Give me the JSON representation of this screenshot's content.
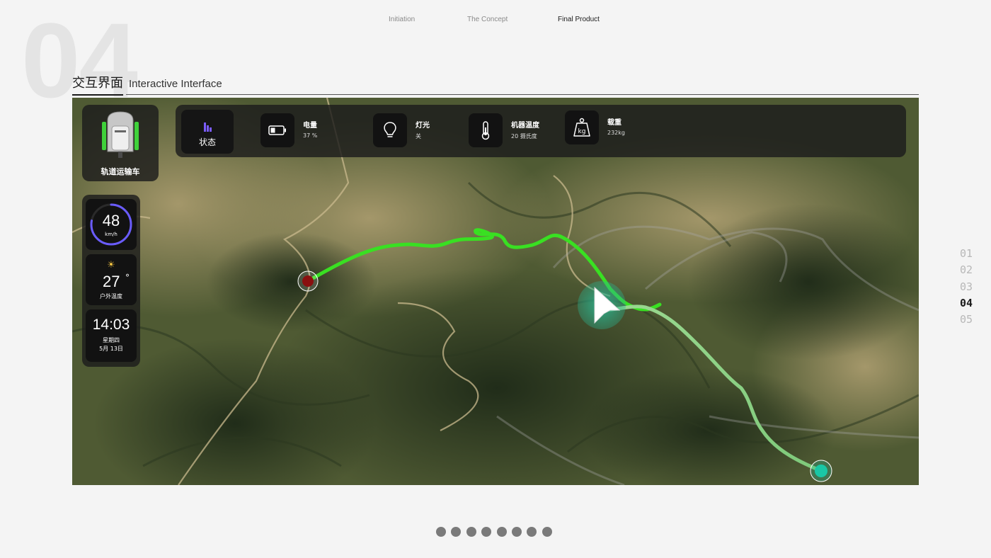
{
  "section_number": "04",
  "nav": {
    "items": [
      {
        "label": "Initiation"
      },
      {
        "label": "The Concept"
      },
      {
        "label": "Final Product"
      }
    ],
    "active": "Final Product"
  },
  "section": {
    "title_zh": "交互界面",
    "title_en": "Interactive Interface"
  },
  "dashboard": {
    "vehicle_label": "轨道运输车",
    "status_tab": "状态",
    "stats": [
      {
        "icon": "battery-icon",
        "title": "电量",
        "value": "37 %"
      },
      {
        "icon": "bulb-icon",
        "title": "灯光",
        "value": "关"
      },
      {
        "icon": "thermometer-icon",
        "title": "机器温度",
        "value": "20 摄氏度"
      },
      {
        "icon": "weight-icon",
        "title": "载重",
        "value": "232kg"
      }
    ],
    "speed": {
      "value": "48",
      "unit": "km/h",
      "gauge_fraction": 0.78
    },
    "weather": {
      "icon": "sun-icon",
      "temp": "27",
      "degree_mark": "°",
      "label": "户外温度"
    },
    "clock": {
      "time": "14:03",
      "weekday": "星期四",
      "date": "5月 13日"
    }
  },
  "page_index": [
    "01",
    "02",
    "03",
    "04",
    "05"
  ],
  "active_page": "04",
  "pagination_dot_count": 8,
  "colors": {
    "route_done": "#39e022",
    "route_pending": "#8fd38a",
    "start_marker": "#8a0f0f",
    "end_marker": "#19c7a6",
    "gauge": "#6a5cff"
  }
}
